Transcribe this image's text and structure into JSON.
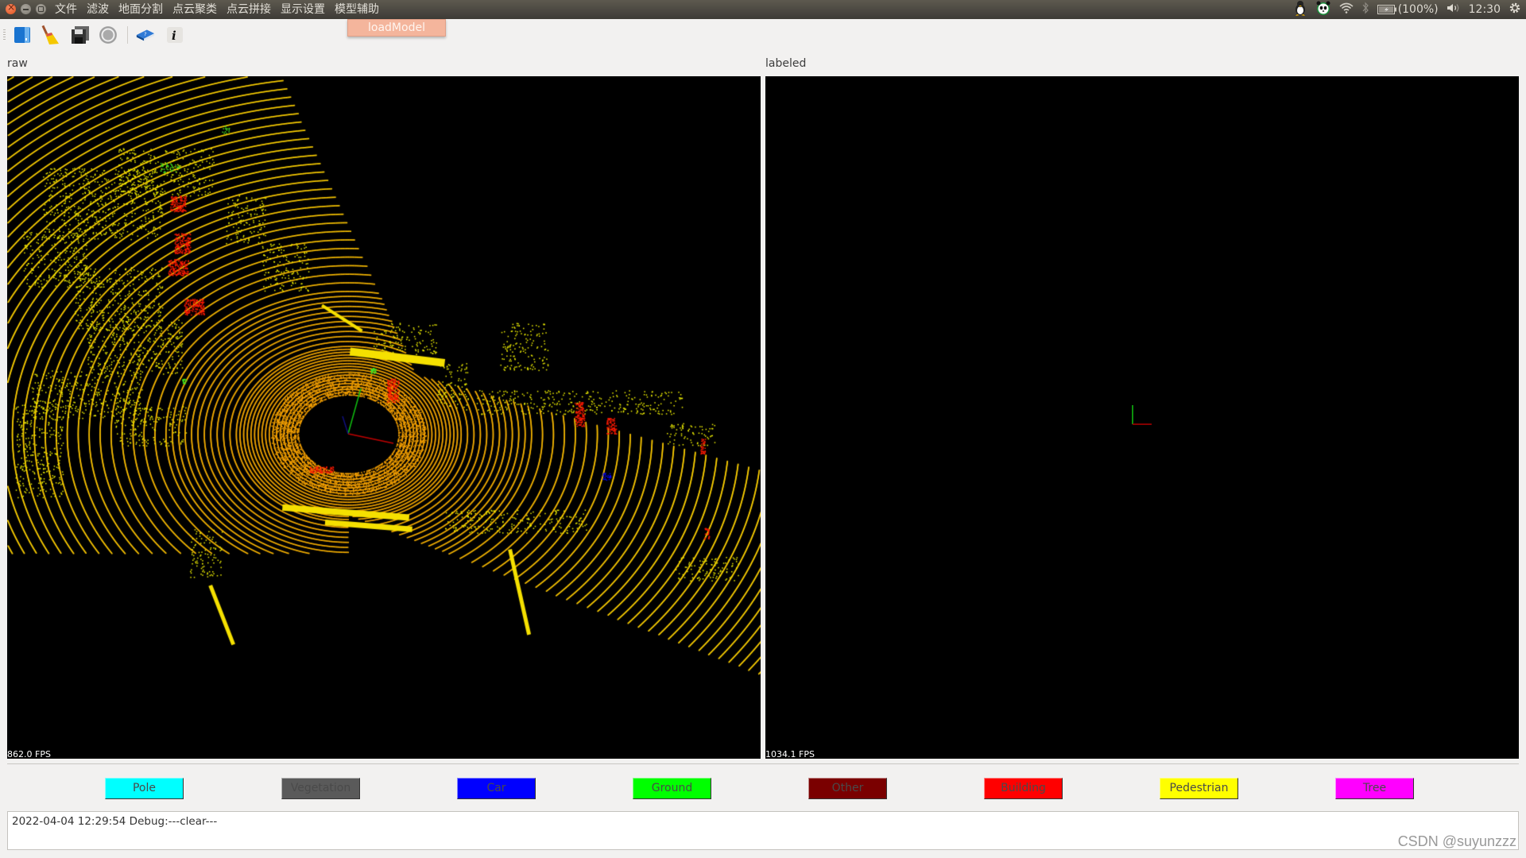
{
  "window": {
    "menus": [
      "文件",
      "滤波",
      "地面分割",
      "点云聚类",
      "点云拼接",
      "显示设置",
      "模型辅助"
    ],
    "open_menu_item": "loadModel"
  },
  "tray": {
    "battery": "(100%)",
    "time": "12:30",
    "icons": [
      "qq-penguin-icon",
      "panda-icon",
      "wifi-icon",
      "bluetooth-icon",
      "battery-icon",
      "volume-icon",
      "power-gear-icon"
    ]
  },
  "toolbar": {
    "buttons": [
      "open-file-icon",
      "clear-broom-icon",
      "save-icon",
      "power-icon",
      "help-book-icon",
      "info-icon"
    ]
  },
  "panes": {
    "raw": {
      "label": "raw",
      "fps": "862.0 FPS"
    },
    "labeled": {
      "label": "labeled",
      "fps": "1034.1 FPS"
    }
  },
  "legend": [
    {
      "label": "Pole",
      "color": "#00ffff"
    },
    {
      "label": "Vegetation",
      "color": "#5a5a5a"
    },
    {
      "label": "Car",
      "color": "#0000ff"
    },
    {
      "label": "Ground",
      "color": "#00ff00"
    },
    {
      "label": "Other",
      "color": "#7a0000"
    },
    {
      "label": "Building",
      "color": "#ff0000"
    },
    {
      "label": "Pedestrian",
      "color": "#ffff00"
    },
    {
      "label": "Tree",
      "color": "#ff00ff"
    }
  ],
  "log": {
    "text": "2022-04-04 12:29:54 Debug:---clear---"
  },
  "watermark": "CSDN @suyunzzz"
}
